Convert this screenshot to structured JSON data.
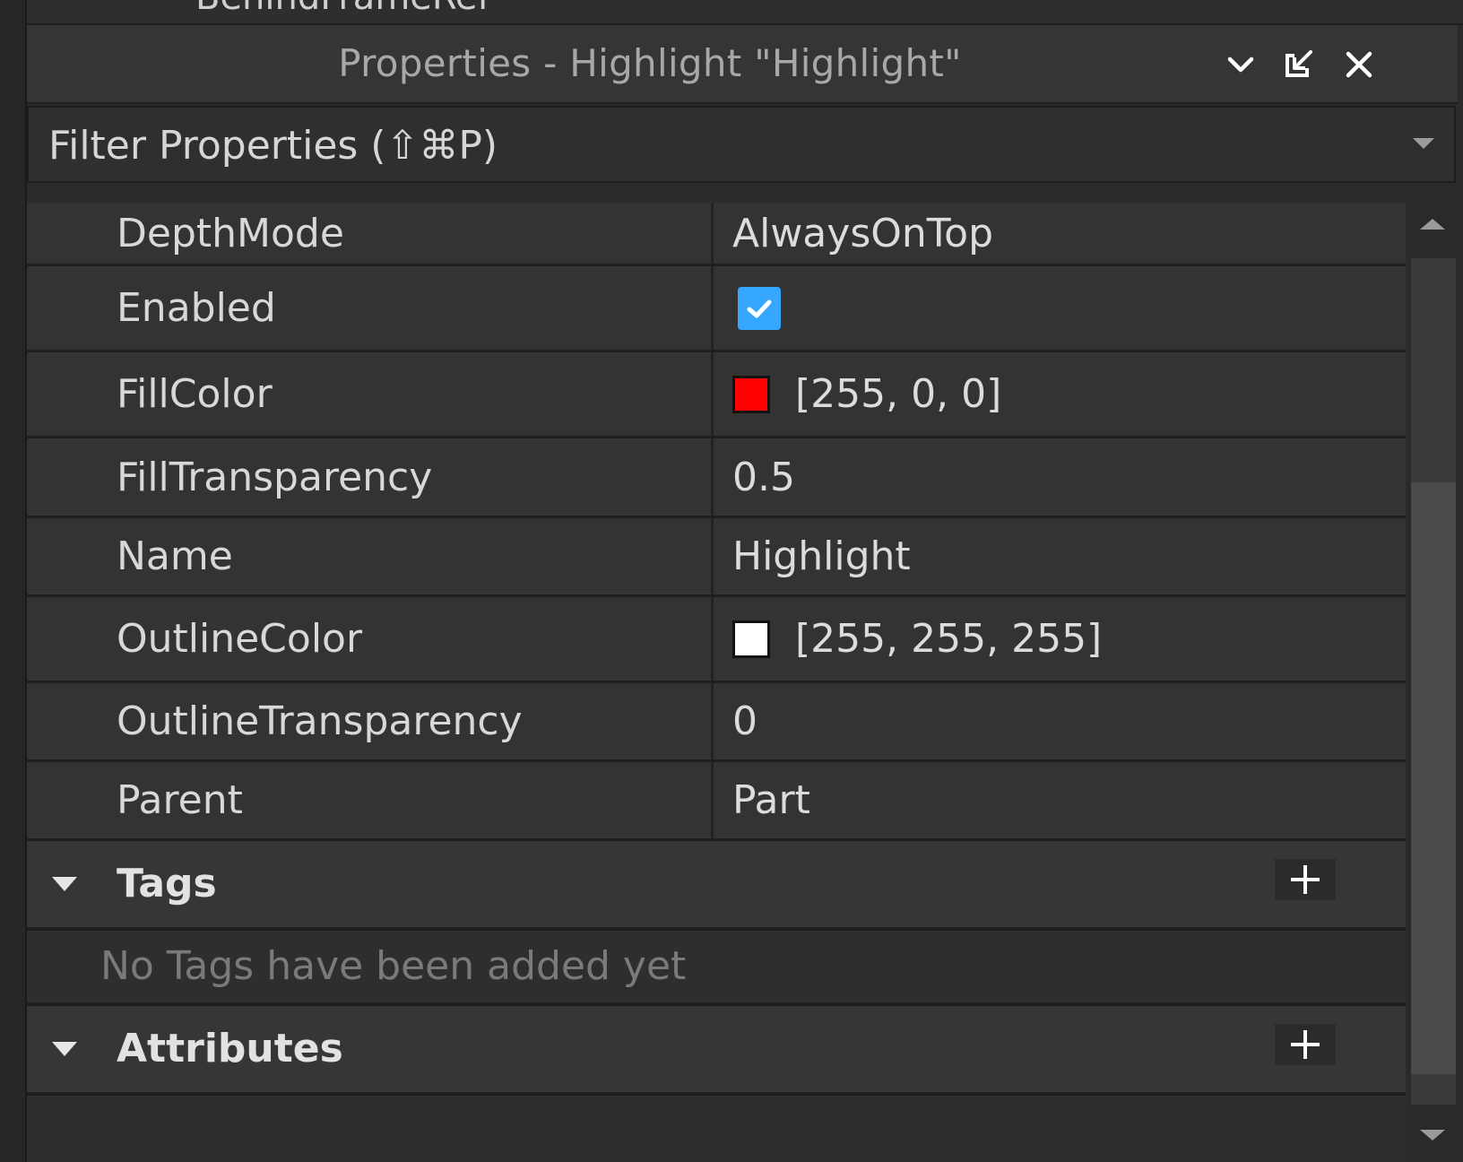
{
  "previous_panel": {
    "cut_text": "BehindFrameRef"
  },
  "window": {
    "title": "Properties - Highlight \"Highlight\"",
    "buttons": {
      "collapse_icon": "chevron-down-icon",
      "undock_icon": "undock-icon",
      "close_icon": "close-icon"
    }
  },
  "filter": {
    "placeholder": "Filter Properties (⇧⌘P)"
  },
  "properties": [
    {
      "name": "DepthMode",
      "value": "AlwaysOnTop"
    },
    {
      "name": "Enabled",
      "checked": true
    },
    {
      "name": "FillColor",
      "value": "[255, 0, 0]",
      "color": "#ff0000"
    },
    {
      "name": "FillTransparency",
      "value": "0.5"
    },
    {
      "name": "Name",
      "value": "Highlight"
    },
    {
      "name": "OutlineColor",
      "value": "[255, 255, 255]",
      "color": "#ffffff"
    },
    {
      "name": "OutlineTransparency",
      "value": "0"
    },
    {
      "name": "Parent",
      "value": "Part"
    }
  ],
  "tags": {
    "title": "Tags",
    "empty_message": "No Tags have been added yet"
  },
  "attributes": {
    "title": "Attributes"
  },
  "colors": {
    "checkbox_accent": "#35a7ff"
  }
}
